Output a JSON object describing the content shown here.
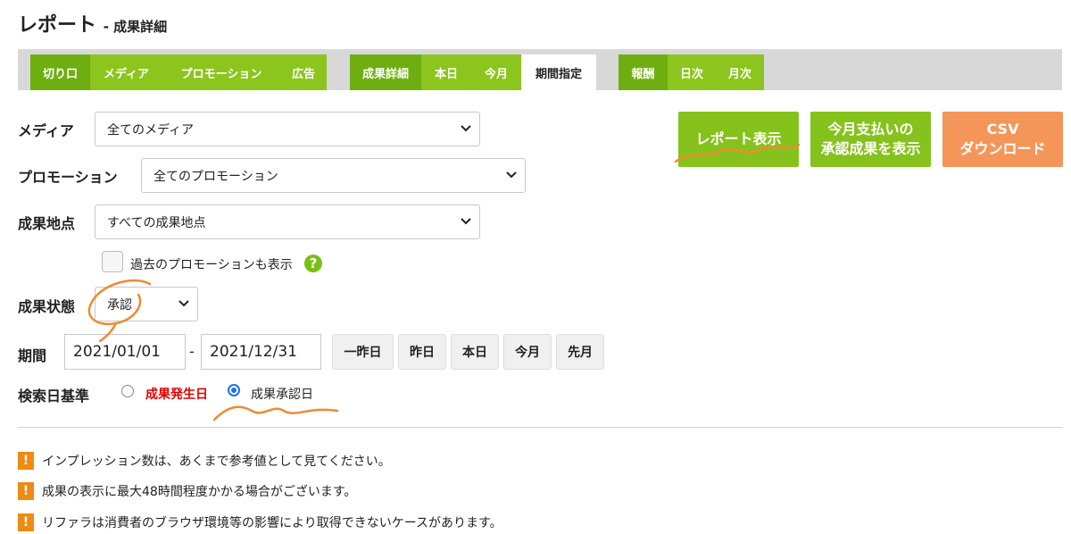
{
  "header": {
    "title": "レポート",
    "subtitle": "- 成果詳細"
  },
  "tabs": {
    "group1": [
      "切り口",
      "メディア",
      "プロモーション",
      "広告"
    ],
    "group2": [
      "成果詳細",
      "本日",
      "今月",
      "期間指定"
    ],
    "group3": [
      "報酬",
      "日次",
      "月次"
    ]
  },
  "filters": {
    "media": {
      "label": "メディア",
      "value": "全てのメディア"
    },
    "promotion": {
      "label": "プロモーション",
      "value": "全てのプロモーション"
    },
    "point": {
      "label": "成果地点",
      "value": "すべての成果地点"
    },
    "past_checkbox": "過去のプロモーションも表示",
    "help": "?",
    "status": {
      "label": "成果状態",
      "value": "承認"
    },
    "period": {
      "label": "期間",
      "start": "2021/01/01",
      "separator": "-",
      "end": "2021/12/31"
    },
    "quick_buttons": [
      "一昨日",
      "昨日",
      "本日",
      "今月",
      "先月"
    ],
    "basis": {
      "label": "検索日基準",
      "option1": "成果発生日",
      "option2": "成果承認日",
      "selected": "成果承認日"
    }
  },
  "actions": {
    "report": "レポート表示",
    "approved_line1": "今月支払いの",
    "approved_line2": "承認成果を表示",
    "csv_line1": "CSV",
    "csv_line2": "ダウンロード"
  },
  "notes": [
    "インプレッション数は、あくまで参考値として見てください。",
    "成果の表示に最大48時間程度かかる場合がございます。",
    "リファラは消費者のブラウザ環境等の影響により取得できないケースがあります。"
  ],
  "note_icon": "!",
  "colors": {
    "green": "#8cc51e",
    "orange_button": "#f4965a",
    "warning": "#ef8a12",
    "annotation": "#f08a30",
    "emphasis_red": "#e00000"
  }
}
